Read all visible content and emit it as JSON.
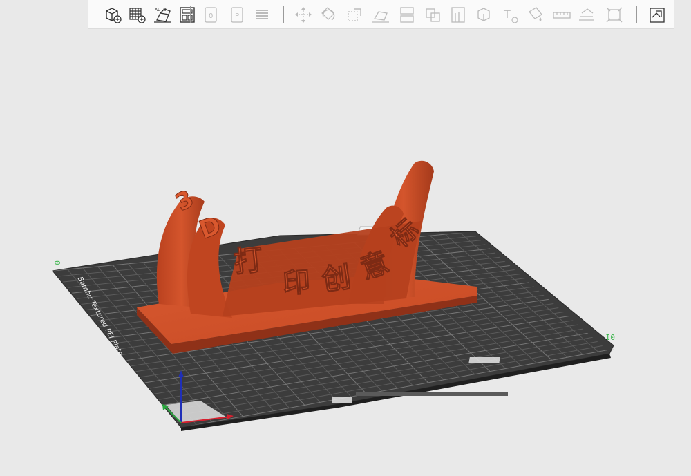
{
  "toolbar": {
    "groups": [
      [
        {
          "name": "add-object-icon",
          "icon": "cube-plus"
        },
        {
          "name": "add-plate-icon",
          "icon": "grid-plus"
        },
        {
          "name": "auto-orient-icon",
          "icon": "auto-orient",
          "text": "AUTO"
        },
        {
          "name": "arrange-icon",
          "icon": "arrange"
        }
      ],
      [
        {
          "name": "plate-settings-icon",
          "icon": "doc-0",
          "text": "0"
        },
        {
          "name": "plate-p-icon",
          "icon": "doc-p",
          "text": "P"
        },
        {
          "name": "layers-icon",
          "icon": "layers"
        }
      ],
      [
        {
          "name": "move-icon",
          "icon": "move"
        },
        {
          "name": "rotate-icon",
          "icon": "rotate"
        },
        {
          "name": "scale-icon",
          "icon": "scale"
        },
        {
          "name": "lay-on-face-icon",
          "icon": "lay-face"
        },
        {
          "name": "cut-icon",
          "icon": "cut"
        },
        {
          "name": "boolean-icon",
          "icon": "boolean"
        },
        {
          "name": "support-paint-icon",
          "icon": "support"
        },
        {
          "name": "seam-paint-icon",
          "icon": "seam"
        },
        {
          "name": "text-tool-icon",
          "icon": "text",
          "text": "T"
        },
        {
          "name": "color-paint-icon",
          "icon": "paint"
        },
        {
          "name": "measure-icon",
          "icon": "measure"
        },
        {
          "name": "variable-layer-icon",
          "icon": "variable"
        },
        {
          "name": "assembly-icon",
          "icon": "assembly"
        }
      ],
      [
        {
          "name": "split-parts-icon",
          "icon": "split"
        }
      ]
    ]
  },
  "bed": {
    "side_label": "Bambu Textured PEI Plate",
    "plate_number": "01",
    "axis_y_tick": "0",
    "grid_color": "#5c5c5c",
    "bed_color": "#3a3a3a"
  },
  "model": {
    "text": "3D打印创意标",
    "color": "#cd4d28",
    "shade_color": "#8f3118",
    "base_color": "#d4542d"
  },
  "axes": {
    "x_color": "#d8202f",
    "y_color": "#2aa83e",
    "z_color": "#1f2fb8"
  }
}
